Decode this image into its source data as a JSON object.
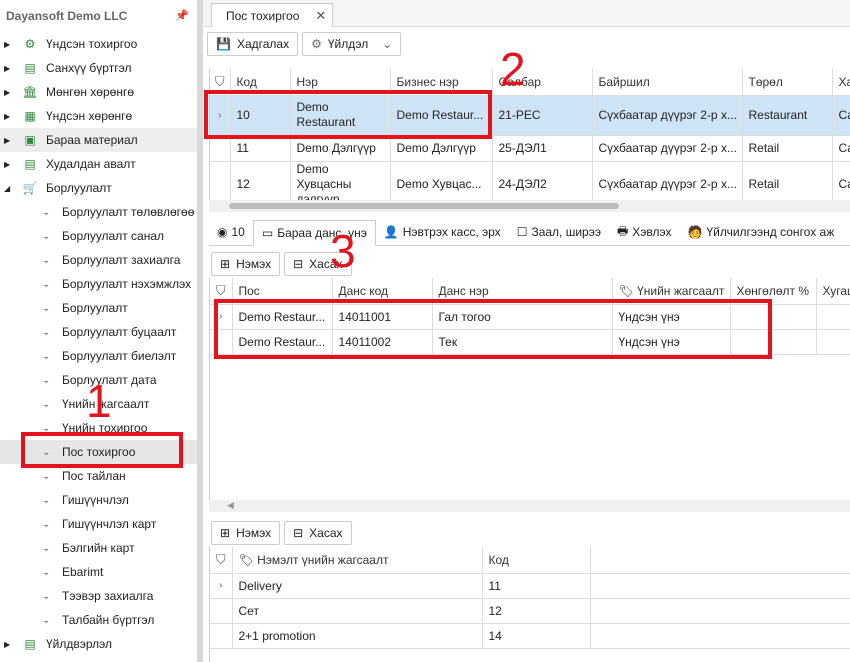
{
  "sidebar": {
    "company": "Dayansoft Demo LLC",
    "items": [
      {
        "label": "Үндсэн тохиргоо",
        "icon": "gear-icon"
      },
      {
        "label": "Санхүү бүртгэл",
        "icon": "ledger-icon"
      },
      {
        "label": "Мөнгөн хөрөнгө",
        "icon": "bank-icon"
      },
      {
        "label": "Үндсэн хөрөнгө",
        "icon": "building-icon"
      },
      {
        "label": "Бараа материал",
        "icon": "box-icon"
      },
      {
        "label": "Худалдан авалт",
        "icon": "ledger-icon"
      },
      {
        "label": "Борлуулалт",
        "icon": "cart-icon"
      }
    ],
    "children": [
      "Борлуулалт төлөвлөгөө",
      "Борлуулалт санал",
      "Борлуулалт захиалга",
      "Борлуулалт нэхэмжлэх",
      "Борлуулалт",
      "Борлуулалт буцаалт",
      "Борлуулалт биелэлт",
      "Борлуулалт дата",
      "Үнийн жагсаалт",
      "Үнийн тохиргоо",
      "Пос тохиргоо",
      "Пос тайлан",
      "Гишүүнчлэл",
      "Гишүүнчлэл карт",
      "Бэлгийн карт",
      "Ebarimt",
      "Тээвэр захиалга",
      "Талбайн бүртгэл"
    ],
    "bottom": "Үйлдвэрлэл"
  },
  "tab": {
    "title": "Пос тохиргоо"
  },
  "toolbar": {
    "save": "Хадгалах",
    "action": "Үйлдэл"
  },
  "grid1": {
    "headers": [
      "Код",
      "Нэр",
      "Бизнес нэр",
      "Салбар",
      "Байршил",
      "Төрөл",
      "Хар"
    ],
    "rows": [
      [
        "10",
        "Demo Restaurant",
        "Demo Restaur...",
        "21-PEC",
        "Сүхбаатар дүүрэг 2-р х...",
        "Restaurant",
        "Сал"
      ],
      [
        "11",
        "Demo Дэлгүүр",
        "Demo Дэлгүүр",
        "25-ДЭЛ1",
        "Сүхбаатар дүүрэг 2-р х...",
        "Retail",
        "Сал"
      ],
      [
        "12",
        "Demo Хувцасны дэлгүүр",
        "Demo Хувцас...",
        "24-ДЭЛ2",
        "Сүхбаатар дүүрэг 2-р х...",
        "Retail",
        "Сал"
      ]
    ]
  },
  "subtabs": {
    "id": "10",
    "t1": "Бараа данс, үнэ",
    "t2": "Нэвтрэх касс, эрх",
    "t3": "Заал, ширээ",
    "t4": "Хэвлэх",
    "t5": "Үйлчилгээнд сонгох аж"
  },
  "buttons": {
    "add": "Нэмэх",
    "remove": "Хасах"
  },
  "grid2": {
    "headers": [
      "Пос",
      "Данс код",
      "Данс нэр",
      "Үнийн жагсаалт",
      "Хөнгөлөлт %",
      "Хугац"
    ],
    "rows": [
      [
        "Demo Restaur...",
        "14011001",
        "Гал тогоо",
        "Үндсэн үнэ"
      ],
      [
        "Demo Restaur...",
        "14011002",
        "Тек",
        "Үндсэн үнэ"
      ]
    ]
  },
  "grid3": {
    "headers": [
      "Нэмэлт үнийн жагсаалт",
      "Код"
    ],
    "rows": [
      [
        "Delivery",
        "11"
      ],
      [
        "Сет",
        "12"
      ],
      [
        "2+1 promotion",
        "14"
      ]
    ]
  },
  "annotations": [
    "1",
    "2",
    "3"
  ],
  "colors": {
    "accent": "#e3141e",
    "selected": "#cfe4f7",
    "icon": "#2f8a3c"
  }
}
